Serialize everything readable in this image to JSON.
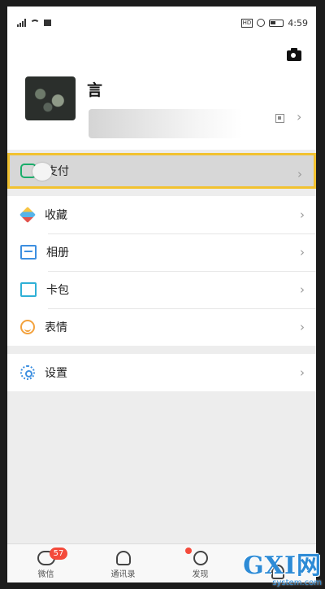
{
  "status_bar": {
    "time": "4:59"
  },
  "profile": {
    "nickname": "言"
  },
  "menu": {
    "pay": "支付",
    "favorites": "收藏",
    "album": "相册",
    "cards": "卡包",
    "stickers": "表情",
    "settings": "设置"
  },
  "tabbar": {
    "chats_label": "微信",
    "chats_badge": "57",
    "contacts_label": "通讯录",
    "discover_label": "发现"
  },
  "watermark": {
    "logo": "GXI网",
    "site": "system.com"
  },
  "colors": {
    "highlight_border": "#f2c230",
    "badge": "#f44a3b",
    "wechat_green": "#1aad6a"
  }
}
